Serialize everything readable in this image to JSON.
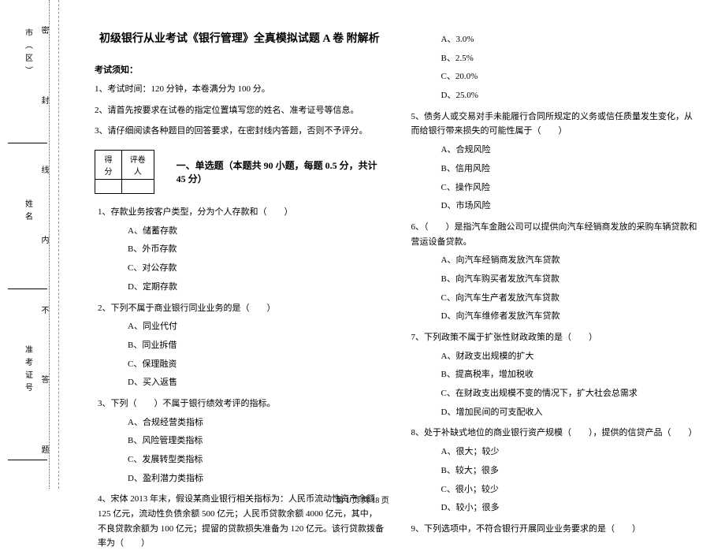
{
  "margin": {
    "labels": [
      "市（区）",
      "姓名",
      "准考证号"
    ],
    "inner": [
      "密",
      "封",
      "线",
      "内",
      "不",
      "答",
      "题"
    ]
  },
  "title": "初级银行从业考试《银行管理》全真模拟试题 A 卷  附解析",
  "notice_header": "考试须知：",
  "notices": [
    "1、考试时间：120 分钟，本卷满分为 100 分。",
    "2、请首先按要求在试卷的指定位置填写您的姓名、准考证号等信息。",
    "3、请仔细阅读各种题目的回答要求，在密封线内答题，否则不予评分。"
  ],
  "score": {
    "c1": "得分",
    "c2": "评卷人"
  },
  "section1_header": "一、单选题（本题共 90 小题，每题 0.5 分，共计 45 分）",
  "left_questions": [
    {
      "q": "1、存款业务按客户类型，分为个人存款和（　　）",
      "opts": [
        "A、储蓄存款",
        "B、外币存款",
        "C、对公存款",
        "D、定期存款"
      ]
    },
    {
      "q": "2、下列不属于商业银行同业业务的是（　　）",
      "opts": [
        "A、同业代付",
        "B、同业拆借",
        "C、保理融资",
        "D、买入返售"
      ]
    },
    {
      "q": "3、下列（　　）不属于银行绩效考评的指标。",
      "opts": [
        "A、合规经营类指标",
        "B、风险管理类指标",
        "C、发展转型类指标",
        "D、盈利潜力类指标"
      ]
    },
    {
      "q": "4、宋体 2013 年末，假设某商业银行相关指标为：人民币流动性资产余额 125 亿元，流动性负债余额 500 亿元；人民币贷款余额 4000 亿元，其中，不良贷款余额为 100 亿元；提留的贷款损失准备为 120 亿元。该行贷款拨备率为（　　）",
      "opts": []
    }
  ],
  "right_top_opts": [
    "A、3.0%",
    "B、2.5%",
    "C、20.0%",
    "D、25.0%"
  ],
  "right_questions": [
    {
      "q": "5、债务人或交易对手未能履行合同所规定的义务或信任质量发生变化，从而给银行带来损失的可能性属于（　　）",
      "opts": [
        "A、合规风险",
        "B、信用风险",
        "C、操作风险",
        "D、市场风险"
      ]
    },
    {
      "q": "6、（　　）是指汽车金融公司可以提供向汽车经销商发放的采购车辆贷款和营运设备贷款。",
      "opts": [
        "A、向汽车经销商发放汽车贷款",
        "B、向汽车购买者发放汽车贷款",
        "C、向汽车生产者发放汽车贷款",
        "D、向汽车维修者发放汽车贷款"
      ]
    },
    {
      "q": "7、下列政策不属于扩张性财政政策的是（　　）",
      "opts": [
        "A、财政支出规模的扩大",
        "B、提高税率，增加税收",
        "C、在财政支出规模不变的情况下，扩大社会总需求",
        "D、增加民间的可支配收入"
      ]
    },
    {
      "q": "8、处于补缺式地位的商业银行资产规模（　　），提供的信贷产品（　　）",
      "opts": [
        "A、很大；较少",
        "B、较大；很多",
        "C、很小；较少",
        "D、较小；很多"
      ]
    },
    {
      "q": "9、下列选项中，不符合银行开展同业业务要求的是（　　）",
      "opts": []
    }
  ],
  "footer": "第 1 页 共 18 页"
}
